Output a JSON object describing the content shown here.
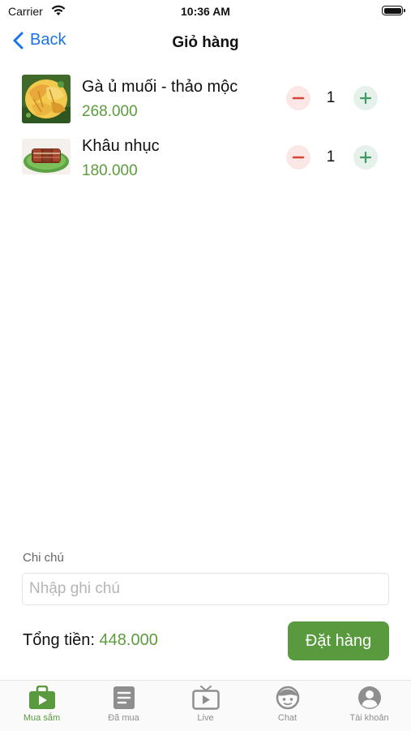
{
  "status_bar": {
    "carrier": "Carrier",
    "time": "10:36 AM"
  },
  "nav": {
    "back_label": "Back",
    "title": "Giỏ hàng"
  },
  "cart": {
    "items": [
      {
        "name": "Gà ủ muối - thảo mộc",
        "price": "268.000",
        "quantity": "1",
        "image": "salted-chicken-photo"
      },
      {
        "name": "Khâu nhục",
        "price": "180.000",
        "quantity": "1",
        "image": "braised-pork-photo"
      }
    ]
  },
  "note": {
    "label": "Chi chú",
    "placeholder": "Nhập ghi chú",
    "value": ""
  },
  "summary": {
    "total_label": "Tổng tiền:",
    "total_value": "448.000",
    "order_button": "Đặt hàng"
  },
  "tabs": [
    {
      "label": "Mua sắm",
      "icon": "shopping-bag-icon",
      "active": true
    },
    {
      "label": "Đã mua",
      "icon": "receipt-icon",
      "active": false
    },
    {
      "label": "Live",
      "icon": "tv-icon",
      "active": false
    },
    {
      "label": "Chat",
      "icon": "chat-face-icon",
      "active": false
    },
    {
      "label": "Tài khoản",
      "icon": "account-icon",
      "active": false
    }
  ],
  "colors": {
    "accent": "#5a9a3e",
    "link": "#1a73e8",
    "minus_bg": "#fbe7e6",
    "minus": "#d9433a",
    "plus_bg": "#e5f1ea",
    "plus": "#3f9a63"
  }
}
